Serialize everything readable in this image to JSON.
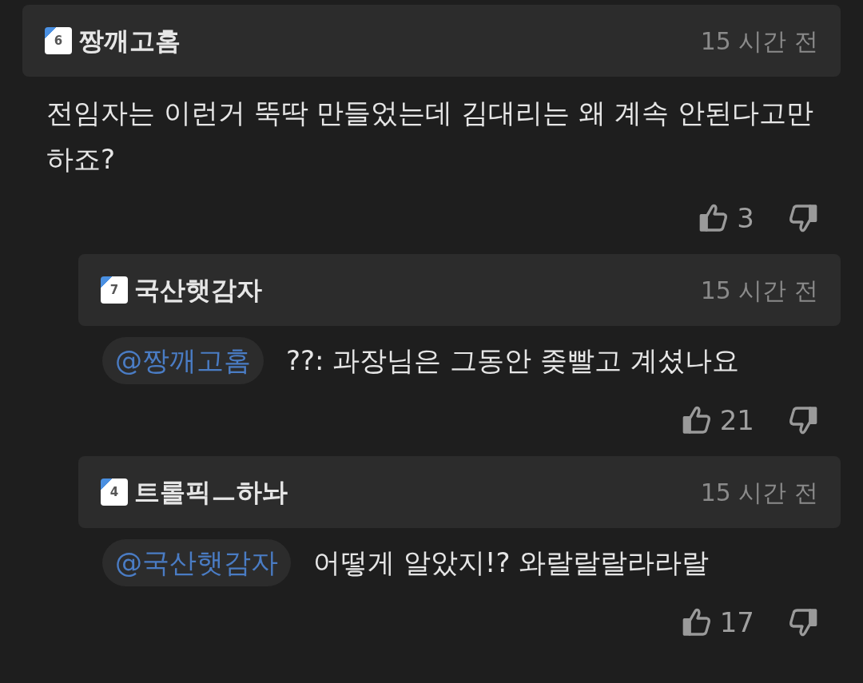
{
  "comments": [
    {
      "level_badge": "6",
      "author": "짱깨고홈",
      "time": "15 시간 전",
      "text": "전임자는 이런거 뚝딱 만들었는데 김대리는 왜 계속 안된다고만 하죠?",
      "likes": "3",
      "children": [
        {
          "level_badge": "7",
          "author": "국산햇감자",
          "time": "15 시간 전",
          "mention": "@짱깨고홈",
          "text": "??: 과장님은 그동안 좆빨고 계셨나요",
          "likes": "21"
        },
        {
          "level_badge": "4",
          "author": "트롤픽ㅡ하놔",
          "time": "15 시간 전",
          "mention": "@국산햇감자",
          "text": "어떻게 알았지!? 와랄랄랄라라랄",
          "likes": "17"
        }
      ]
    }
  ]
}
